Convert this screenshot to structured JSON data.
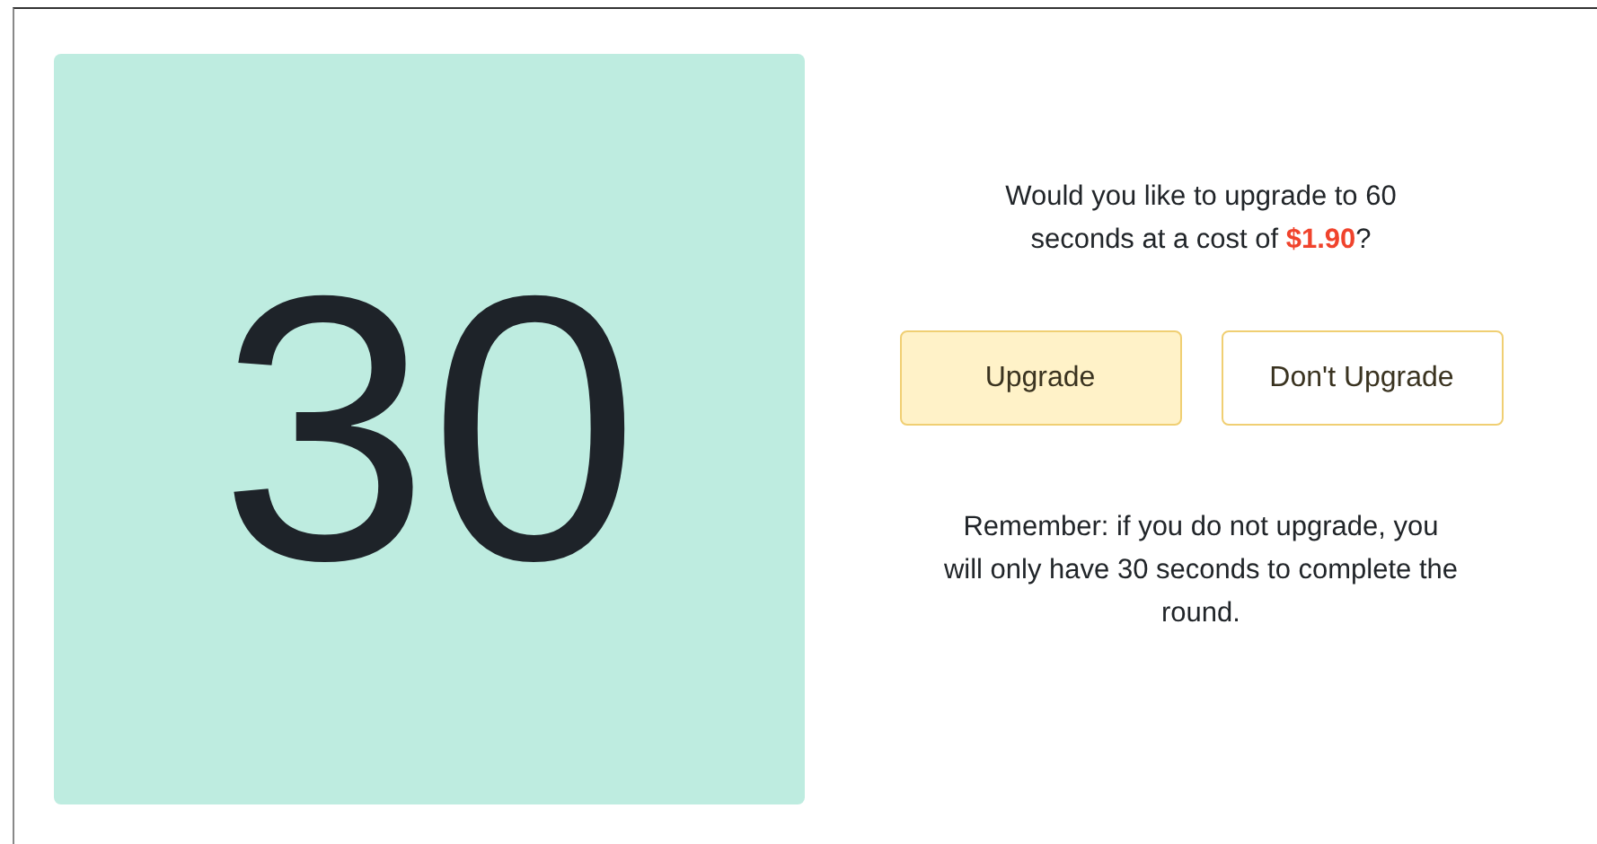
{
  "timer": {
    "value": "30"
  },
  "offer": {
    "question": "Would you like to upgrade to 60 seconds at a cost of **$1.90**?"
  },
  "buttons": [
    {
      "label": "Upgrade",
      "selected": true
    },
    {
      "label": "Don't Upgrade",
      "selected": false
    }
  ],
  "reminder": "Remember: if you do not upgrade, you will only have 30 seconds to complete the round."
}
